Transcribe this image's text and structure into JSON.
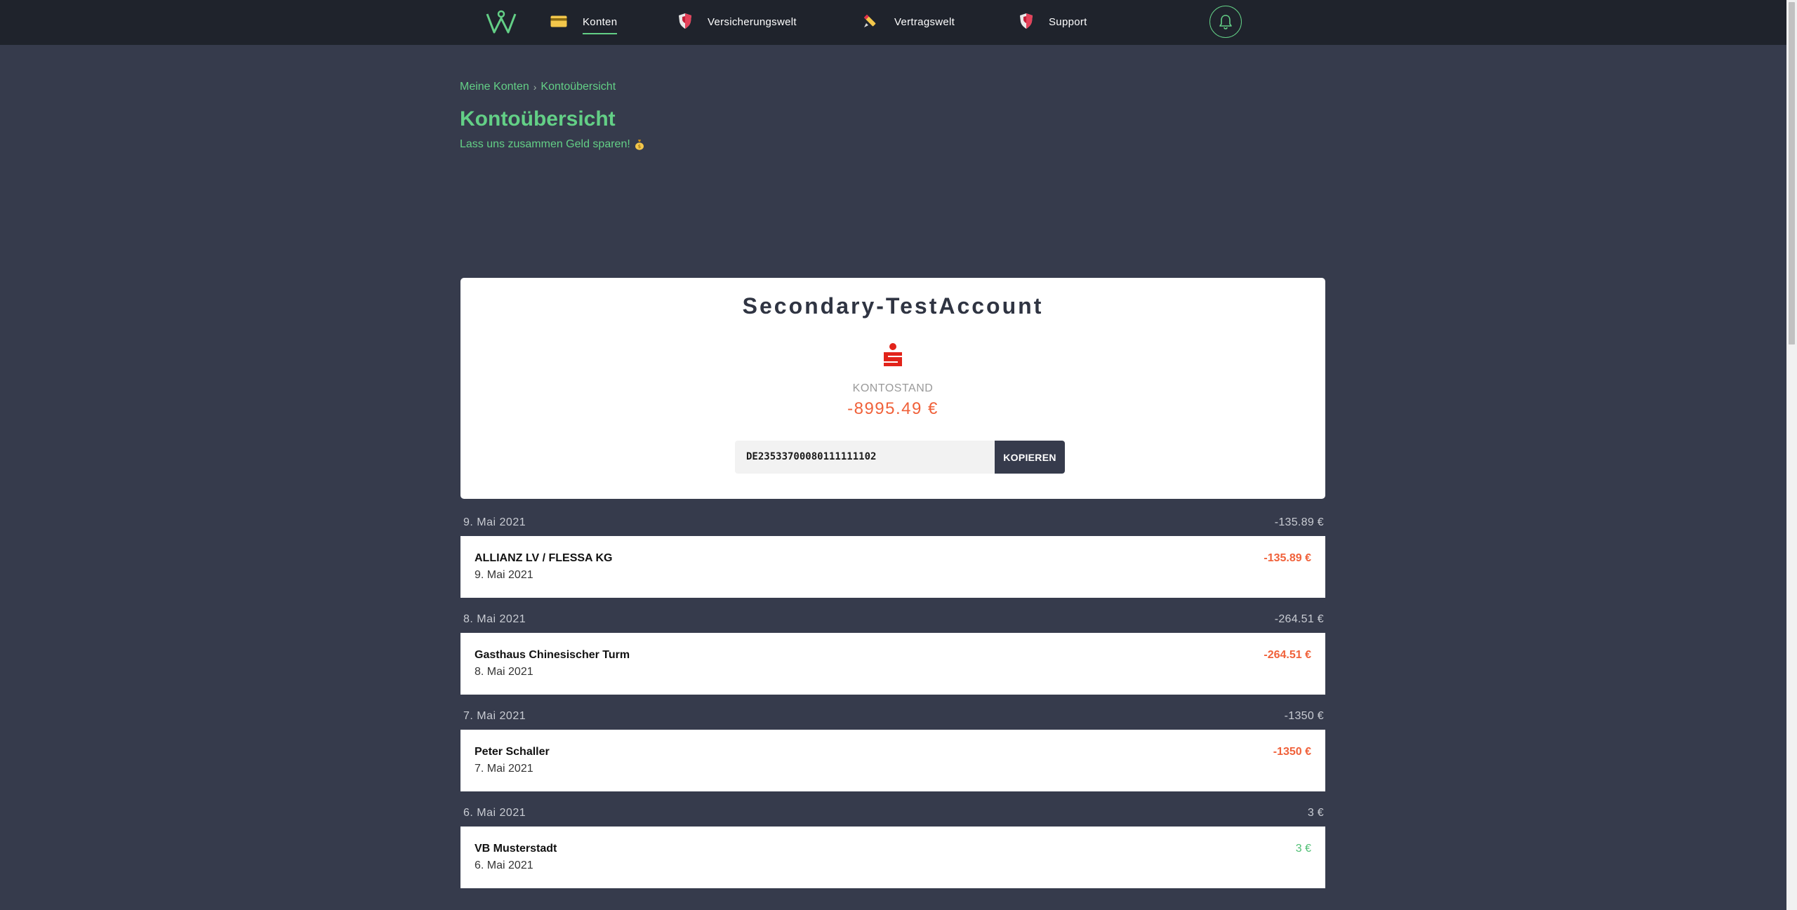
{
  "nav": {
    "items": [
      {
        "label": "Konten",
        "icon": "credit-card-icon",
        "active": true
      },
      {
        "label": "Versicherungswelt",
        "icon": "shield-icon",
        "active": false
      },
      {
        "label": "Vertragswelt",
        "icon": "pen-icon",
        "active": false
      },
      {
        "label": "Support",
        "icon": "shield-icon",
        "active": false
      }
    ],
    "logo_icon": "w-logo-icon",
    "bell_icon": "bell-icon"
  },
  "breadcrumb": {
    "items": [
      "Meine Konten",
      "Kontoübersicht"
    ]
  },
  "page": {
    "title": "Kontoübersicht",
    "subtitle": "Lass uns zusammen Geld sparen!",
    "subtitle_icon": "money-bag-icon"
  },
  "account": {
    "name": "Secondary-TestAccount",
    "bank_logo_icon": "sparkasse-logo-icon",
    "balance_label": "KONTOSTAND",
    "balance": "-8995.49 €",
    "iban": "DE23533700080111111102",
    "copy_label": "KOPIEREN"
  },
  "transactions": [
    {
      "date": "9. Mai 2021",
      "sum": "-135.89 €",
      "name": "ALLIANZ LV / FLESSA KG",
      "amount": "-135.89 €",
      "negative": true
    },
    {
      "date": "8. Mai 2021",
      "sum": "-264.51 €",
      "name": "Gasthaus Chinesischer Turm",
      "amount": "-264.51 €",
      "negative": true
    },
    {
      "date": "7. Mai 2021",
      "sum": "-1350 €",
      "name": "Peter Schaller",
      "amount": "-1350 €",
      "negative": true
    },
    {
      "date": "6. Mai 2021",
      "sum": "3 €",
      "name": "VB Musterstadt",
      "amount": "3 €",
      "negative": false
    }
  ],
  "colors": {
    "background": "#363b4c",
    "topbar": "#1f232c",
    "accent": "#63cf86",
    "negative": "#f0613a",
    "positive": "#4fbf74"
  }
}
